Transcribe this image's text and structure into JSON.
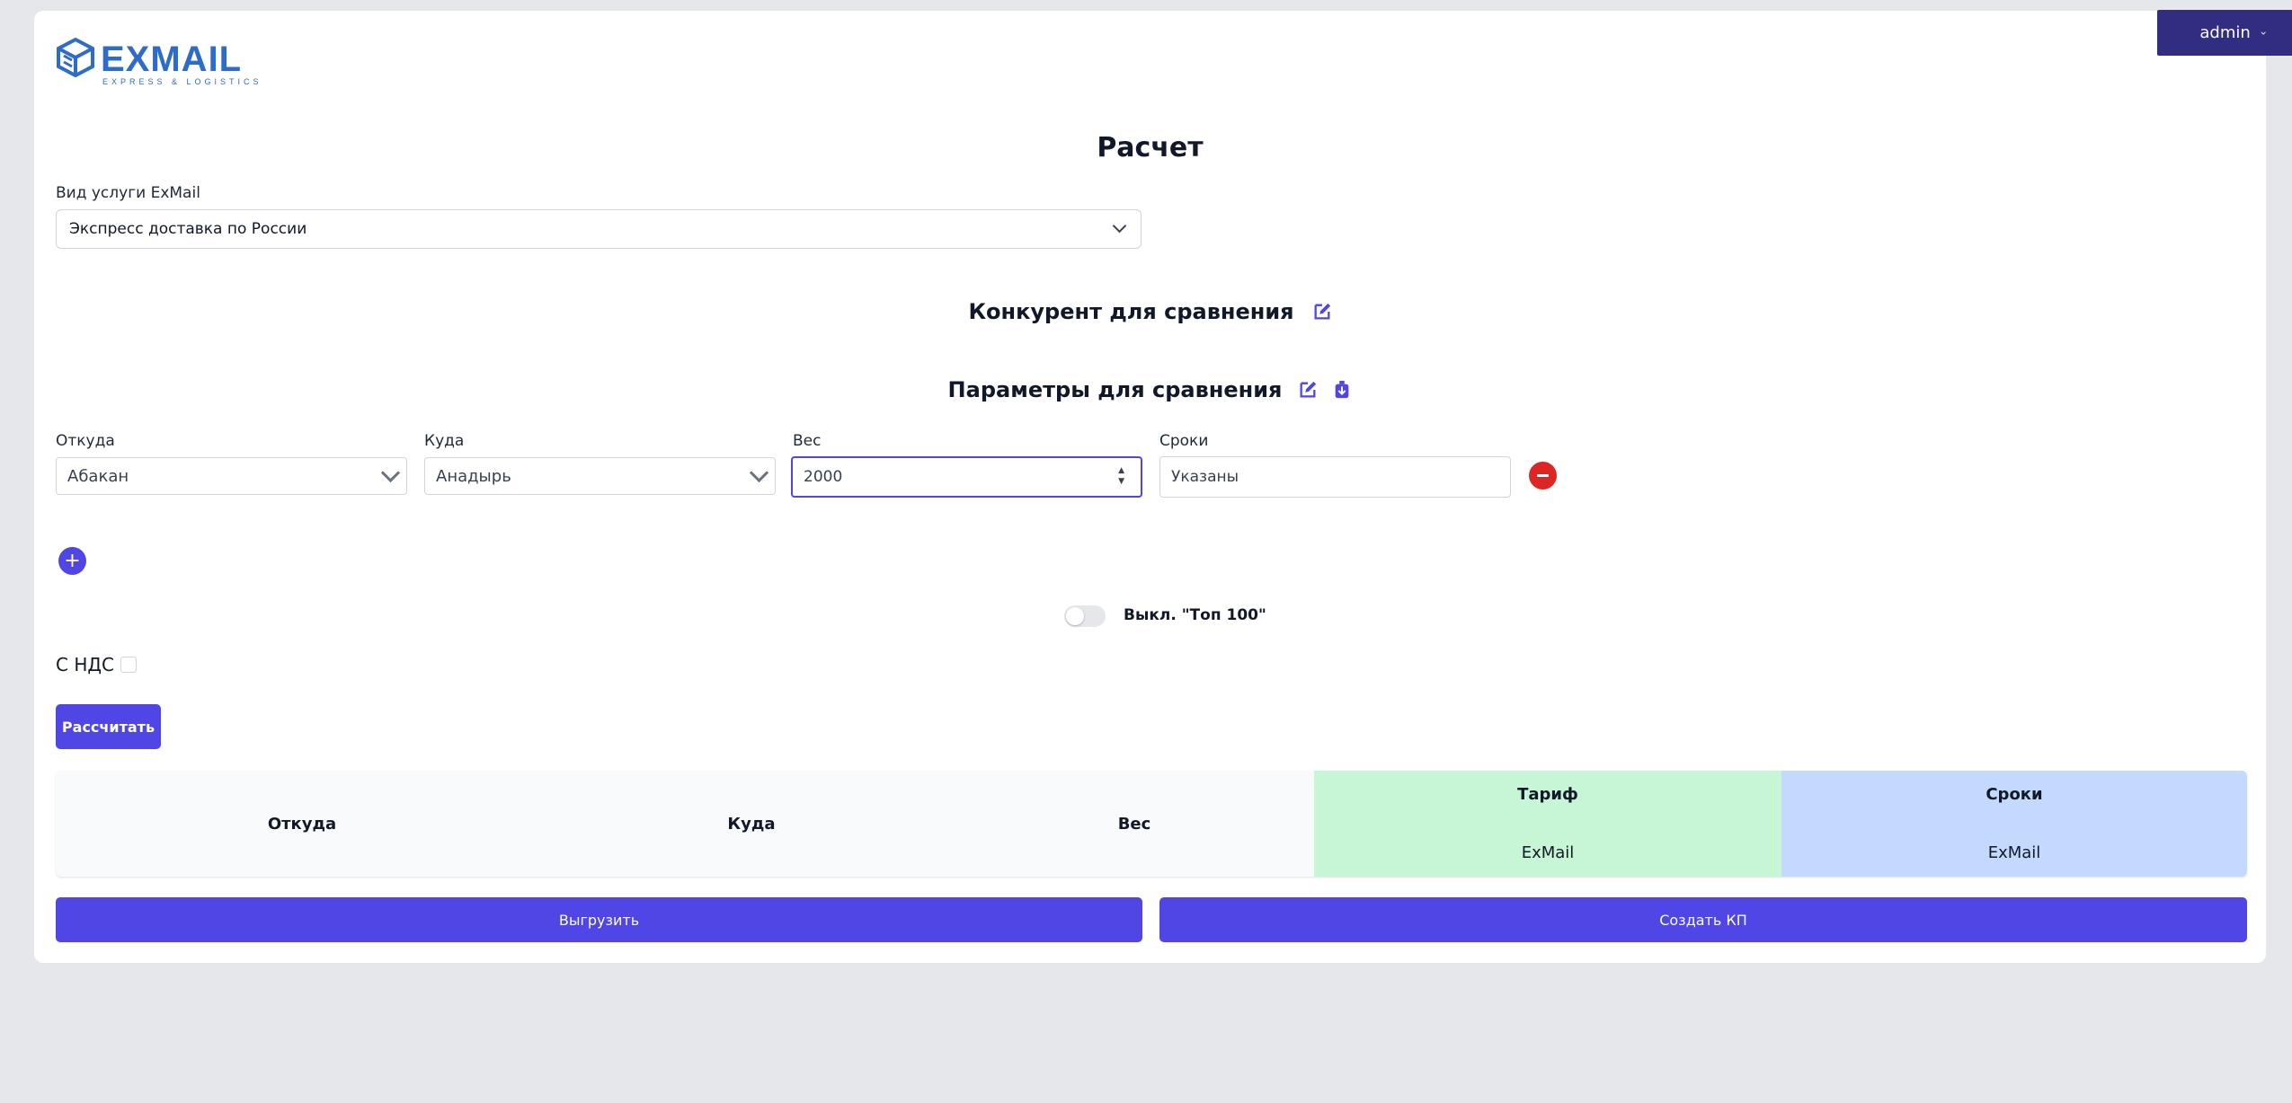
{
  "header": {
    "logo_text": "EXMAIL",
    "logo_subtitle": "EXPRESS & LOGISTICS",
    "user_menu_label": "admin"
  },
  "page": {
    "title": "Расчет"
  },
  "service": {
    "label": "Вид услуги ExMail",
    "selected": "Экспресс доставка по России"
  },
  "competitor": {
    "title": "Конкурент для сравнения"
  },
  "params": {
    "title": "Параметры для сравнения",
    "from_label": "Откуда",
    "from_value": "Абакан",
    "to_label": "Куда",
    "to_value": "Анадырь",
    "weight_label": "Вес",
    "weight_value": "2000",
    "terms_label": "Сроки",
    "terms_value": "Указаны"
  },
  "toggle": {
    "label": "Выкл. \"Топ 100\"",
    "state": "off"
  },
  "vat": {
    "label": "С НДС",
    "checked": false
  },
  "actions": {
    "calculate_label": "Рассчитать",
    "export_label": "Выгрузить",
    "create_offer_label": "Создать КП"
  },
  "results_table": {
    "columns": [
      {
        "label": "Откуда",
        "sub": ""
      },
      {
        "label": "Куда",
        "sub": ""
      },
      {
        "label": "Вес",
        "sub": ""
      },
      {
        "label": "Тариф",
        "sub": "ExMail"
      },
      {
        "label": "Сроки",
        "sub": "ExMail"
      }
    ]
  },
  "colors": {
    "primary": "#4f46e5",
    "admin_bg": "#312e81",
    "danger": "#dc2626",
    "tariff_bg": "#c6f6d5",
    "terms_bg": "#c3dafe",
    "logo": "#2d6cc8"
  }
}
